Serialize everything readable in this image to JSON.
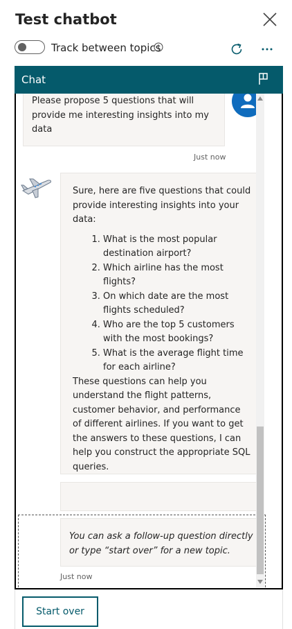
{
  "header": {
    "title": "Test chatbot",
    "close_icon": "close-icon"
  },
  "toolbar": {
    "toggle_label": "Track between topics",
    "toggle_state": "off",
    "info_icon": "info-icon",
    "refresh_icon": "refresh-icon",
    "more_icon": "more-options-icon"
  },
  "chat": {
    "header_label": "Chat",
    "flag_icon": "flag-icon",
    "accent_color": "#055a6b",
    "user_message": "Please propose 5 questions that will provide me interesting insights into my data",
    "user_timestamp": "Just now",
    "bot_intro": "Sure, here are five questions that could provide interesting insights into your data:",
    "bot_questions": [
      "What is the most popular destination airport?",
      "Which airline has the most flights?",
      "On which date are the most flights scheduled?",
      "Who are the top 5 customers with the most bookings?",
      "What is the average flight time for each airline?"
    ],
    "bot_outro": "These questions can help you understand the flight patterns, customer behavior, and performance of different airlines. If you want to get the answers to these questions, I can help you construct the appropriate SQL queries.",
    "follow_up": "You can ask a follow-up question directly or type “start over” for a new topic.",
    "follow_timestamp": "Just now"
  },
  "footer": {
    "start_over_label": "Start over"
  }
}
